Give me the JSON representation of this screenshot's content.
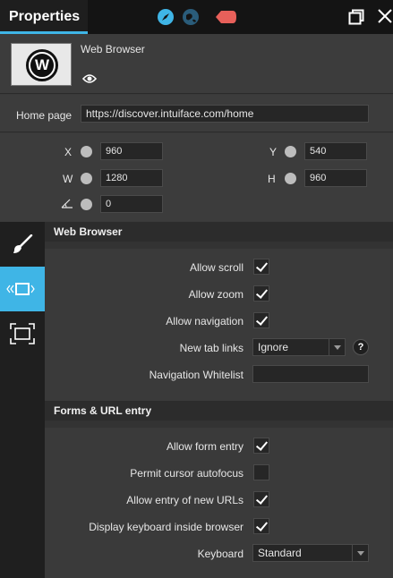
{
  "titlebar": {
    "title": "Properties"
  },
  "header": {
    "asset_name": "Web Browser",
    "logo_letter": "W"
  },
  "home_page": {
    "label": "Home page",
    "value": "https://discover.intuiface.com/home"
  },
  "transform": {
    "x_label": "X",
    "x_value": "960",
    "y_label": "Y",
    "y_value": "540",
    "w_label": "W",
    "w_value": "1280",
    "h_label": "H",
    "h_value": "960",
    "rotation_value": "0"
  },
  "sections": {
    "web_browser": {
      "title": "Web Browser",
      "allow_scroll": {
        "label": "Allow scroll",
        "checked": true
      },
      "allow_zoom": {
        "label": "Allow zoom",
        "checked": true
      },
      "allow_navigation": {
        "label": "Allow navigation",
        "checked": true
      },
      "new_tab_links": {
        "label": "New tab links",
        "value": "Ignore",
        "help": "?"
      },
      "navigation_whitelist": {
        "label": "Navigation Whitelist",
        "value": ""
      }
    },
    "forms": {
      "title": "Forms & URL entry",
      "allow_form_entry": {
        "label": "Allow form entry",
        "checked": true
      },
      "permit_cursor_autofocus": {
        "label": "Permit cursor autofocus",
        "checked": false
      },
      "allow_entry_new_urls": {
        "label": "Allow entry of new URLs",
        "checked": true
      },
      "display_keyboard": {
        "label": "Display keyboard inside browser",
        "checked": true
      },
      "keyboard": {
        "label": "Keyboard",
        "value": "Standard"
      }
    }
  },
  "colors": {
    "accent": "#3fb5e6",
    "tag": "#e8605a",
    "panel": "#3a3a3a",
    "titlebar": "#141414"
  }
}
